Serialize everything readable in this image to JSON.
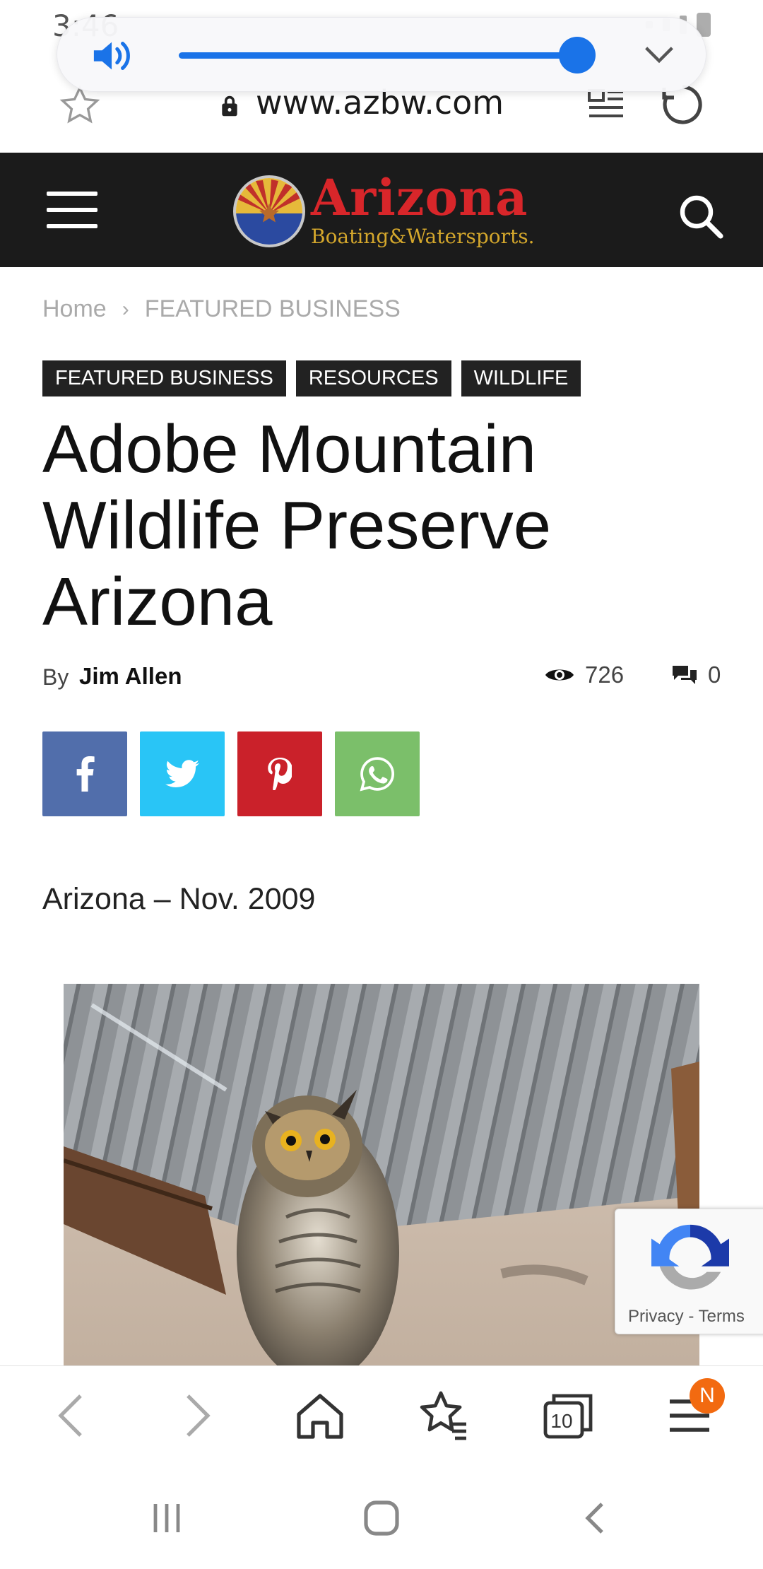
{
  "status_bar": {
    "time": "3:46"
  },
  "volume_panel": {
    "level": 0.94
  },
  "browser": {
    "url": "www.azbw.com",
    "tab_count": "10",
    "menu_badge": "N"
  },
  "site": {
    "logo_word": "Arizona",
    "logo_sub": "Boating&Watersports."
  },
  "breadcrumb": {
    "home": "Home",
    "separator": "›",
    "current": "FEATURED BUSINESS"
  },
  "tags": [
    "FEATURED BUSINESS",
    "RESOURCES",
    "WILDLIFE"
  ],
  "article": {
    "title_line1": "Adobe Mountain",
    "title_line2": "Wildlife Preserve",
    "title_line3": "Arizona",
    "by_label": "By",
    "author": "Jim Allen",
    "views": "726",
    "comments": "0",
    "dateline": "Arizona – Nov. 2009"
  },
  "recaptcha": {
    "privacy": "Privacy",
    "separator": " - ",
    "terms": "Terms"
  },
  "colors": {
    "header_bg": "#1b1b1b",
    "accent_blue": "#1a73e8",
    "facebook": "#516eab",
    "twitter": "#29c5f6",
    "pinterest": "#ca212a",
    "whatsapp": "#7bbf6a",
    "badge": "#f26a10"
  }
}
